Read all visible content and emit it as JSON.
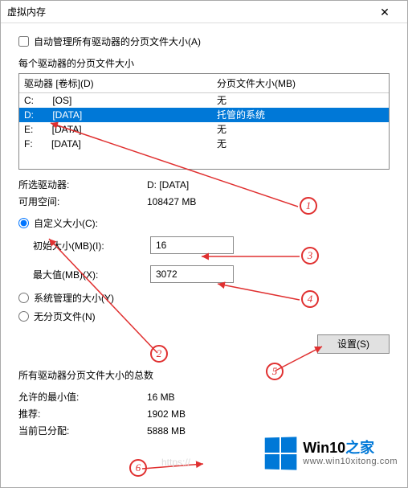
{
  "window": {
    "title": "虚拟内存"
  },
  "auto_manage": {
    "label": "自动管理所有驱动器的分页文件大小(A)",
    "checked": false
  },
  "per_drive_label": "每个驱动器的分页文件大小",
  "list_header": {
    "drive": "驱动器 [卷标](D)",
    "paging": "分页文件大小(MB)"
  },
  "drives": [
    {
      "drive": "C:",
      "label": "[OS]",
      "paging": "无",
      "selected": false
    },
    {
      "drive": "D:",
      "label": "[DATA]",
      "paging": "托管的系统",
      "selected": true
    },
    {
      "drive": "E:",
      "label": "[DATA]",
      "paging": "无",
      "selected": false
    },
    {
      "drive": "F:",
      "label": "[DATA]",
      "paging": "无",
      "selected": false
    }
  ],
  "selected_drive": {
    "label": "所选驱动器:",
    "value": "D:  [DATA]"
  },
  "free_space": {
    "label": "可用空间:",
    "value": "108427 MB"
  },
  "custom_size": {
    "label": "自定义大小(C):",
    "selected": true
  },
  "initial_size": {
    "label": "初始大小(MB)(I):",
    "value": "16"
  },
  "max_size": {
    "label": "最大值(MB)(X):",
    "value": "3072"
  },
  "system_managed": {
    "label": "系统管理的大小(Y)",
    "selected": false
  },
  "no_paging": {
    "label": "无分页文件(N)",
    "selected": false
  },
  "set_button": {
    "label": "设置(S)"
  },
  "totals_label": "所有驱动器分页文件大小的总数",
  "min_allowed": {
    "label": "允许的最小值:",
    "value": "16 MB"
  },
  "recommended": {
    "label": "推荐:",
    "value": "1902 MB"
  },
  "allocated": {
    "label": "当前已分配:",
    "value": "5888 MB"
  },
  "annotations": [
    "1",
    "2",
    "3",
    "4",
    "5",
    "6"
  ],
  "watermark": {
    "brand_a": "Win10",
    "brand_b": "之家",
    "url": "www.win10xitong.com"
  },
  "ghost_url": "https://"
}
